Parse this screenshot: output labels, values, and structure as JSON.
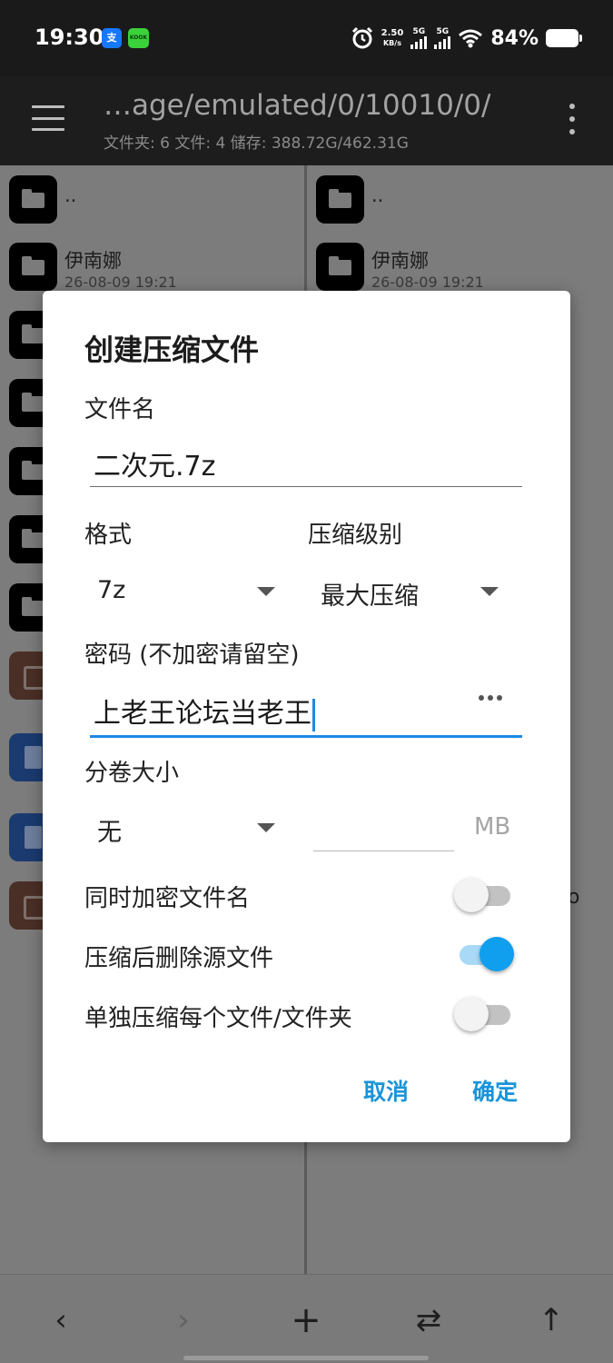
{
  "status_bar": {
    "time": "19:30",
    "app_icons": [
      {
        "name": "alipay-icon",
        "glyph": "支",
        "color": "#1677ff"
      },
      {
        "name": "kook-icon",
        "glyph": "KOOK",
        "color": "#3ad13a"
      }
    ],
    "net_speed": "2.50",
    "net_speed_unit": "KB/s",
    "signal_1": "5G",
    "signal_2": "5G",
    "battery": "84%"
  },
  "app_bar": {
    "path": "…age/emulated/0/10010/0/",
    "info": "文件夹: 6  文件: 4  储存: 388.72G/462.31G"
  },
  "left_pane": {
    "rows": [
      {
        "type": "folder",
        "name": "..",
        "date": ""
      },
      {
        "type": "folder",
        "name": "伊南娜",
        "date": "26-08-09 19:21"
      },
      {
        "type": "folder",
        "name": "",
        "date": ""
      },
      {
        "type": "folder",
        "name": "",
        "date": ""
      },
      {
        "type": "folder",
        "name": "",
        "date": ""
      },
      {
        "type": "folder",
        "name": "",
        "date": ""
      },
      {
        "type": "folder",
        "name": "",
        "date": ""
      },
      {
        "type": "archive",
        "name": "",
        "date": ""
      },
      {
        "type": "doc",
        "name": "",
        "date": ""
      },
      {
        "type": "doc",
        "name": "",
        "date": ""
      },
      {
        "type": "archive",
        "name": "",
        "date": ""
      }
    ]
  },
  "right_pane": {
    "rows": [
      {
        "type": "folder",
        "name": "..",
        "date": ""
      },
      {
        "type": "folder",
        "name": "伊南娜",
        "date": "26-08-09 19:21"
      }
    ],
    "stray_text": "o"
  },
  "dialog": {
    "title": "创建压缩文件",
    "filename_label": "文件名",
    "filename_value": "二次元.7z",
    "format_label": "格式",
    "format_value": "7z",
    "level_label": "压缩级别",
    "level_value": "最大压缩",
    "password_label": "密码 (不加密请留空)",
    "password_value": "上老王论坛当老王",
    "split_label": "分卷大小",
    "split_value": "无",
    "split_size_value": "",
    "split_unit": "MB",
    "options": [
      {
        "label": "同时加密文件名",
        "on": false
      },
      {
        "label": "压缩后删除源文件",
        "on": true
      },
      {
        "label": "单独压缩每个文件/文件夹",
        "on": false
      }
    ],
    "cancel_label": "取消",
    "ok_label": "确定",
    "accent_color": "#1a94d8"
  },
  "bottom_bar": {
    "back": "‹",
    "forward": "›",
    "add": "+",
    "swap": "⇄",
    "up": "↑"
  }
}
